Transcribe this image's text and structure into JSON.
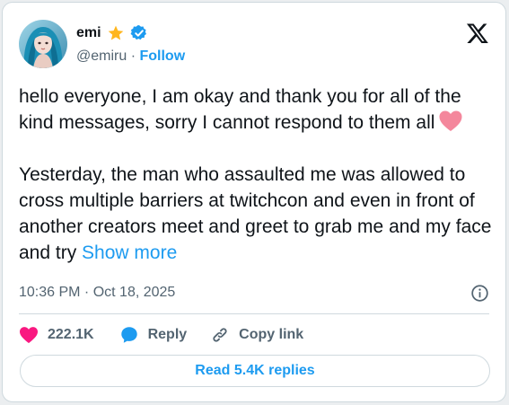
{
  "author": {
    "name": "emi",
    "handle": "@emiru",
    "separator": "·",
    "follow_label": "Follow",
    "avatar_icon": "avatar-photo",
    "badge_icons": [
      "star-icon",
      "verified-badge-icon"
    ]
  },
  "platform_icon": "x-logo-icon",
  "tweet": {
    "line1": "hello everyone, I am okay and thank you for all of the kind messages, sorry I cannot respond to them all",
    "line1_emoji": "pink-heart-icon",
    "line2": "Yesterday, the man who assaulted me was allowed to cross multiple barriers at twitchcon and even in front of another creators meet and greet to grab me and my face and try",
    "show_more_label": "Show more"
  },
  "timestamp": "10:36 PM · Oct 18, 2025",
  "actions": {
    "like_count": "222.1K",
    "reply_label": "Reply",
    "copy_link_label": "Copy link"
  },
  "read_replies_label": "Read 5.4K replies",
  "colors": {
    "accent": "#1d9bf0",
    "like_red": "#f91880",
    "muted_text": "#536471",
    "border": "#cfd9de",
    "star": "#ffb61e"
  }
}
